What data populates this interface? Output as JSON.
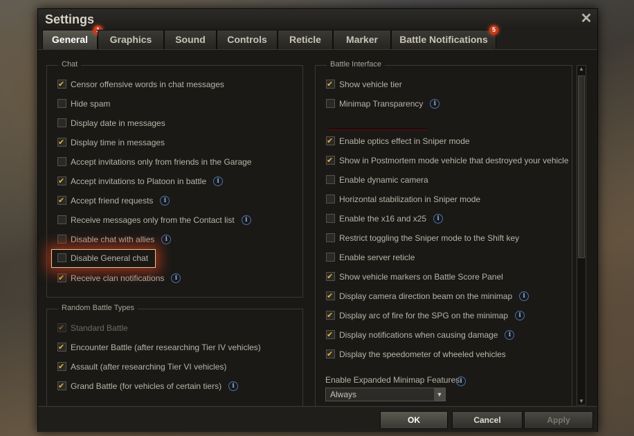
{
  "window": {
    "title": "Settings"
  },
  "tabs": [
    {
      "label": "General",
      "badge": "1"
    },
    {
      "label": "Graphics"
    },
    {
      "label": "Sound"
    },
    {
      "label": "Controls"
    },
    {
      "label": "Reticle"
    },
    {
      "label": "Marker"
    },
    {
      "label": "Battle Notifications",
      "badge": "5"
    }
  ],
  "chat": {
    "title": "Chat",
    "items": [
      {
        "label": "Censor offensive words in chat messages",
        "checked": true
      },
      {
        "label": "Hide spam",
        "checked": false
      },
      {
        "label": "Display date in messages",
        "checked": false
      },
      {
        "label": "Display time in messages",
        "checked": true
      },
      {
        "label": "Accept invitations only from friends in the Garage",
        "checked": false
      },
      {
        "label": "Accept invitations to Platoon in battle",
        "checked": true,
        "info": true
      },
      {
        "label": "Accept friend requests",
        "checked": true,
        "info": true
      },
      {
        "label": "Receive messages only from the Contact list",
        "checked": false,
        "info": true
      },
      {
        "label": "Disable chat with allies",
        "checked": false,
        "info": true
      },
      {
        "label": "Disable General chat",
        "checked": false
      },
      {
        "label": "Receive clan notifications",
        "checked": true,
        "info": true
      }
    ]
  },
  "random_battle": {
    "title": "Random Battle Types",
    "items": [
      {
        "label": "Standard Battle",
        "checked": true,
        "disabled": true
      },
      {
        "label": "Encounter Battle (after researching Tier IV vehicles)",
        "checked": true
      },
      {
        "label": "Assault (after researching Tier VI vehicles)",
        "checked": true
      },
      {
        "label": "Grand Battle (for vehicles of certain tiers)",
        "checked": true,
        "info": true
      }
    ]
  },
  "battle_interface": {
    "title": "Battle Interface",
    "items": [
      {
        "label": "Show vehicle tier",
        "checked": true
      },
      {
        "label": "Minimap Transparency",
        "checked": false,
        "info": true
      },
      {
        "label": "Enable optics effect in Sniper mode",
        "checked": true
      },
      {
        "label": "Show in Postmortem mode vehicle that destroyed your vehicle",
        "checked": true
      },
      {
        "label": "Enable dynamic camera",
        "checked": false
      },
      {
        "label": "Horizontal stabilization in Sniper mode",
        "checked": false
      },
      {
        "label": "Enable the x16 and x25",
        "checked": false,
        "info": true
      },
      {
        "label": "Restrict toggling the Sniper mode to the Shift key",
        "checked": false
      },
      {
        "label": "Enable server reticle",
        "checked": false
      },
      {
        "label": "Show vehicle markers on Battle Score Panel",
        "checked": true
      },
      {
        "label": "Display camera direction beam on the minimap",
        "checked": true,
        "info": true
      },
      {
        "label": "Display arc of fire for the SPG on the minimap",
        "checked": true,
        "info": true
      },
      {
        "label": "Display notifications when causing damage",
        "checked": true,
        "info": true
      },
      {
        "label": "Display the speedometer of wheeled vehicles",
        "checked": true
      }
    ],
    "minimap_label": "Enable Expanded Minimap Features",
    "minimap_value": "Always"
  },
  "footer": {
    "ok": "OK",
    "cancel": "Cancel",
    "apply": "Apply"
  },
  "colors": {
    "accent": "#e8b040",
    "badge": "#c83a1a",
    "highlight": "#e8c890"
  },
  "icons": {
    "close": "close-icon",
    "info": "info-icon",
    "check": "checkmark-icon"
  }
}
